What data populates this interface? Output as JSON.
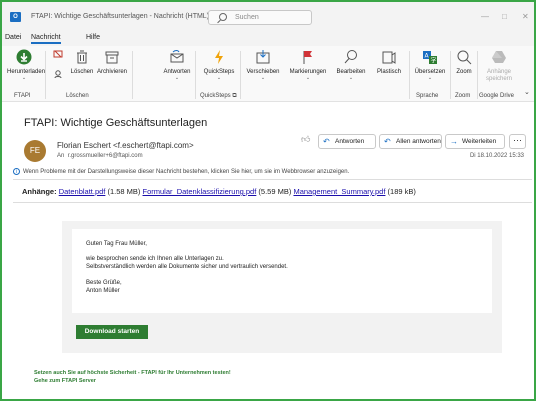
{
  "window": {
    "title": "FTAPI: Wichtige Geschäftsunterlagen - Nachricht (HTML)",
    "search_placeholder": "Suchen",
    "app_icon": "O",
    "minimize": "—",
    "maximize": "□",
    "close": "✕"
  },
  "menu": {
    "tabs": [
      "Datei",
      "Nachricht",
      "Hilfe"
    ],
    "active": "Nachricht"
  },
  "ribbon": {
    "buttons": [
      {
        "label": "Herunterladen",
        "icon": "download-icon"
      },
      {
        "label": "Löschen",
        "icon": "delete-icon"
      },
      {
        "label": "Archivieren",
        "icon": "archive-icon"
      },
      {
        "label": "Antworten",
        "icon": "reply-envelope-icon"
      },
      {
        "label": "QuickSteps",
        "icon": "lightning-icon"
      },
      {
        "label": "Verschieben",
        "icon": "move-folder-icon"
      },
      {
        "label": "Markierungen",
        "icon": "flag-icon"
      },
      {
        "label": "Bearbeiten",
        "icon": "search-edit-icon"
      },
      {
        "label": "Plastisch",
        "icon": "immersive-reader-icon"
      },
      {
        "label": "Übersetzen",
        "icon": "translate-icon"
      },
      {
        "label": "Zoom",
        "icon": "zoom-icon"
      },
      {
        "label": "Anhänge speichern",
        "icon": "google-drive-icon"
      }
    ],
    "groups": [
      "FTAPI",
      "Löschen",
      "QuickSteps",
      "Sprache",
      "Zoom",
      "Google Drive"
    ],
    "dialog_launcher": "⧉"
  },
  "message": {
    "subject": "FTAPI: Wichtige Geschäftsunterlagen",
    "avatar_initials": "FE",
    "avatar_color": "#a97a31",
    "from": "Florian Eschert <f.eschert@ftapi.com>",
    "to_label": "An",
    "to": "r.grossmueller+6@ftapi.com",
    "date": "Di 18.10.2022 15:33",
    "actions": {
      "reply": "Antworten",
      "reply_all": "Allen antworten",
      "forward": "Weiterleiten",
      "more": "···"
    },
    "info_bar": "Wenn Probleme mit der Darstellungsweise dieser Nachricht bestehen, klicken Sie hier, um sie im Webbrowser anzuzeigen.",
    "attachments_label": "Anhänge:",
    "attachments": [
      {
        "name": "Datenblatt.pdf",
        "size": "(1.58 MB)"
      },
      {
        "name": "Formular_Datenklassifizierung.pdf",
        "size": "(5.59 MB)"
      },
      {
        "name": "Management_Summary.pdf",
        "size": "(189 kB)"
      }
    ]
  },
  "body": {
    "greeting": "Guten Tag Frau Müller,",
    "line1": "wie besprochen sende ich Ihnen alle Unterlagen zu.",
    "line2": "Selbstverständlich werden alle Dokumente sicher und vertraulich versendet.",
    "closing": "Beste Grüße,",
    "signature": "Anton Müller",
    "download_button": "Download starten",
    "footer_line1": "Setzen auch Sie auf höchste Sicherheit - FTAPI für Ihr Unternehmen testen!",
    "footer_line2": "Gehe zum FTAPI Server"
  },
  "colors": {
    "accent": "#1b6ec2",
    "frame": "#3aa646",
    "download_button": "#2e7d32"
  }
}
